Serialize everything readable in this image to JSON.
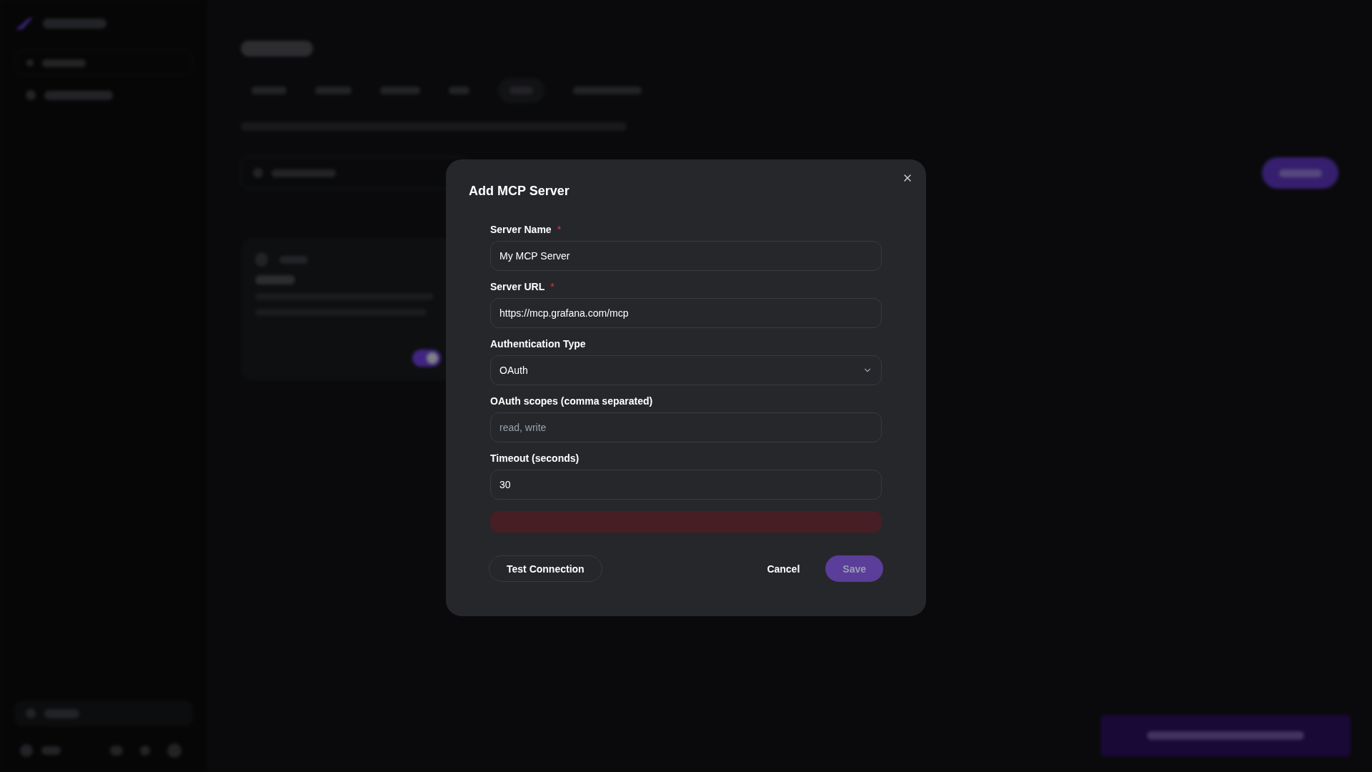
{
  "page": {
    "cards": [
      {
        "on": true
      }
    ]
  },
  "dialog": {
    "title": "Add MCP Server",
    "fields": [
      {
        "kind": "text",
        "label": "Server Name",
        "required_mark": "*",
        "value": "My MCP Server"
      },
      {
        "kind": "text",
        "label": "Server URL",
        "required_mark": "*",
        "value": "https://mcp.grafana.com/mcp"
      },
      {
        "kind": "select",
        "label": "Authentication Type",
        "value": "OAuth"
      },
      {
        "kind": "text",
        "label": "OAuth scopes (comma separated)",
        "placeholder": "read, write"
      },
      {
        "kind": "text",
        "label": "Timeout (seconds)",
        "value": "30"
      }
    ],
    "error": true,
    "test_button": "Test Connection",
    "cancel_button": "Cancel",
    "save_button": {
      "label": "Save",
      "disabled": true
    }
  }
}
